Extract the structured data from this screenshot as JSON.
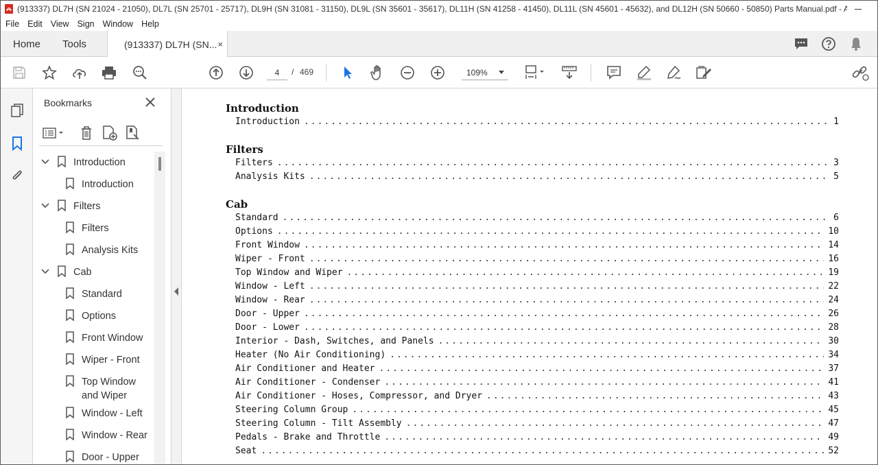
{
  "window": {
    "title": "(913337) DL7H (SN 21024 - 21050), DL7L (SN 25701 - 25717), DL9H (SN 31081 - 31150), DL9L (SN 35601 - 35617), DL11H (SN 41258 - 41450), DL11L (SN 45601 - 45632), and DL12H (SN 50660 - 50850) Parts Manual.pdf - Adobe Acrob..."
  },
  "menu": [
    "File",
    "Edit",
    "View",
    "Sign",
    "Window",
    "Help"
  ],
  "tabs": {
    "home": "Home",
    "tools": "Tools",
    "doc": "(913337) DL7H (SN...",
    "close": "×"
  },
  "toolbar": {
    "page_current": "4",
    "page_sep": "/",
    "page_total": "469",
    "zoom": "109%"
  },
  "bookmarks": {
    "title": "Bookmarks",
    "items": [
      {
        "label": "Introduction",
        "level": 0,
        "expanded": true
      },
      {
        "label": "Introduction",
        "level": 1
      },
      {
        "label": "Filters",
        "level": 0,
        "expanded": true
      },
      {
        "label": "Filters",
        "level": 1
      },
      {
        "label": "Analysis Kits",
        "level": 1
      },
      {
        "label": "Cab",
        "level": 0,
        "expanded": true
      },
      {
        "label": "Standard",
        "level": 1
      },
      {
        "label": "Options",
        "level": 1
      },
      {
        "label": "Front Window",
        "level": 1
      },
      {
        "label": "Wiper - Front",
        "level": 1
      },
      {
        "label": "Top Window and Wiper",
        "level": 1
      },
      {
        "label": "Window - Left",
        "level": 1
      },
      {
        "label": "Window - Rear",
        "level": 1
      },
      {
        "label": "Door - Upper",
        "level": 1
      }
    ]
  },
  "toc": [
    {
      "heading": "Introduction",
      "entries": [
        {
          "label": "Introduction",
          "page": "1"
        }
      ]
    },
    {
      "heading": "Filters",
      "entries": [
        {
          "label": "Filters",
          "page": "3"
        },
        {
          "label": "Analysis Kits",
          "page": "5"
        }
      ]
    },
    {
      "heading": "Cab",
      "entries": [
        {
          "label": "Standard",
          "page": "6"
        },
        {
          "label": "Options",
          "page": "10"
        },
        {
          "label": "Front Window",
          "page": "14"
        },
        {
          "label": "Wiper - Front",
          "page": "16"
        },
        {
          "label": "Top Window and Wiper",
          "page": "19"
        },
        {
          "label": "Window - Left",
          "page": "22"
        },
        {
          "label": "Window - Rear",
          "page": "24"
        },
        {
          "label": "Door - Upper",
          "page": "26"
        },
        {
          "label": "Door - Lower",
          "page": "28"
        },
        {
          "label": "Interior - Dash, Switches, and Panels",
          "page": "30"
        },
        {
          "label": "Heater (No Air Conditioning)",
          "page": "34"
        },
        {
          "label": "Air Conditioner and Heater",
          "page": "37"
        },
        {
          "label": "Air Conditioner - Condenser",
          "page": "41"
        },
        {
          "label": "Air Conditioner - Hoses, Compressor, and Dryer",
          "page": "43"
        },
        {
          "label": "Steering Column Group",
          "page": "45"
        },
        {
          "label": "Steering Column - Tilt Assembly",
          "page": "47"
        },
        {
          "label": "Pedals - Brake and Throttle",
          "page": "49"
        },
        {
          "label": "Seat",
          "page": "52"
        }
      ]
    }
  ],
  "colors": {
    "accent": "#1a73e8",
    "pdf_red": "#d52b1e"
  }
}
